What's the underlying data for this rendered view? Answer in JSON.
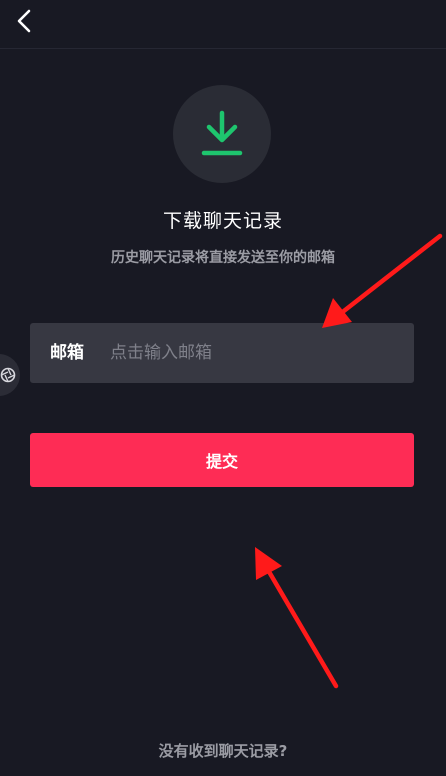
{
  "header": {
    "back_icon": "chevron-left-icon"
  },
  "hero": {
    "icon": "download-icon",
    "icon_color": "#1ec56e",
    "title": "下载聊天记录",
    "subtitle": "历史聊天记录将直接发送至你的邮箱"
  },
  "form": {
    "email_label": "邮箱",
    "email_placeholder": "点击输入邮箱",
    "email_value": "",
    "submit_label": "提交"
  },
  "footer": {
    "help_link": "没有收到聊天记录?"
  },
  "colors": {
    "background": "#181923",
    "accent": "#fe2c55",
    "annotation_arrow": "#ff1a1a"
  }
}
